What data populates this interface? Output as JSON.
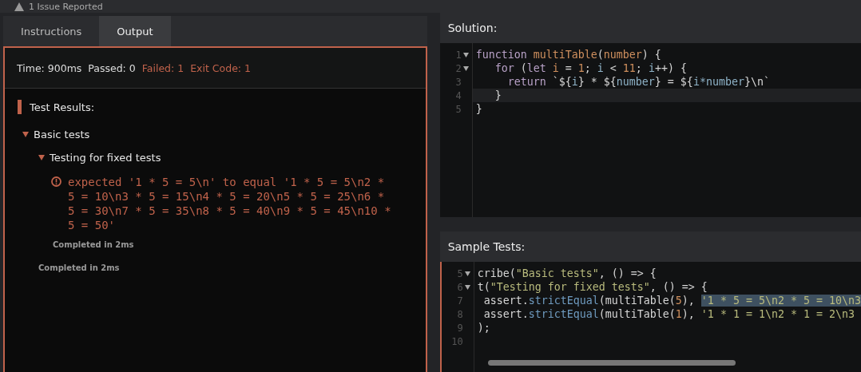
{
  "top_bar": {
    "text": "1 Issue Reported"
  },
  "tabs": [
    {
      "label": "Instructions",
      "selected": false
    },
    {
      "label": "Output",
      "selected": true
    }
  ],
  "output": {
    "stats": [
      {
        "text": "Time: 900ms",
        "failed": false
      },
      {
        "text": "Passed: 0",
        "failed": false
      },
      {
        "text": "Failed: 1",
        "failed": true
      },
      {
        "text": "Exit Code: 1",
        "failed": true
      }
    ],
    "heading": "Test Results:",
    "groups": [
      {
        "title": "Basic tests",
        "expanded": true,
        "completed": "Completed in 2ms",
        "children": [
          {
            "title": "Testing for fixed tests",
            "expanded": true,
            "completed": "Completed in 2ms",
            "error": "expected '1 * 5 = 5\\n' to equal '1 * 5 = 5\\n2 * 5 = 10\\n3 * 5 = 15\\n4 * 5 = 20\\n5 * 5 = 25\\n6 * 5 = 30\\n7 * 5 = 35\\n8 * 5 = 40\\n9 * 5 = 45\\n10 * 5 = 50'"
          }
        ]
      }
    ]
  },
  "solution": {
    "title": "Solution:",
    "lines": [
      {
        "number": "1",
        "foldable": true,
        "active": false,
        "tokens": [
          {
            "t": "function ",
            "kind": "kw"
          },
          {
            "t": "multiTable",
            "kind": "fn"
          },
          {
            "t": "(",
            "kind": "plain"
          },
          {
            "t": "number",
            "kind": "fn"
          },
          {
            "t": ") {",
            "kind": "plain"
          }
        ]
      },
      {
        "number": "2",
        "foldable": true,
        "active": false,
        "tokens": [
          {
            "t": "   for ",
            "kind": "kw"
          },
          {
            "t": "(",
            "kind": "plain"
          },
          {
            "t": "let ",
            "kind": "kw"
          },
          {
            "t": "i",
            "kind": "fn"
          },
          {
            "t": " = ",
            "kind": "plain"
          },
          {
            "t": "1",
            "kind": "fn"
          },
          {
            "t": "; ",
            "kind": "plain"
          },
          {
            "t": "i",
            "kind": "var"
          },
          {
            "t": " < ",
            "kind": "plain"
          },
          {
            "t": "11",
            "kind": "fn"
          },
          {
            "t": "; ",
            "kind": "plain"
          },
          {
            "t": "i",
            "kind": "var"
          },
          {
            "t": "++) {",
            "kind": "plain"
          }
        ]
      },
      {
        "number": "3",
        "foldable": false,
        "active": false,
        "tokens": [
          {
            "t": "     return ",
            "kind": "kw"
          },
          {
            "t": "`${",
            "kind": "plain"
          },
          {
            "t": "i",
            "kind": "var"
          },
          {
            "t": "} * ${",
            "kind": "plain"
          },
          {
            "t": "number",
            "kind": "var"
          },
          {
            "t": "} = ${",
            "kind": "plain"
          },
          {
            "t": "i*number",
            "kind": "var"
          },
          {
            "t": "}\\n`",
            "kind": "plain"
          }
        ]
      },
      {
        "number": "4",
        "foldable": false,
        "active": true,
        "tokens": [
          {
            "t": "   }",
            "kind": "plain"
          }
        ]
      },
      {
        "number": "5",
        "foldable": false,
        "active": false,
        "tokens": [
          {
            "t": "}",
            "kind": "plain"
          }
        ]
      }
    ]
  },
  "sample_tests": {
    "title": "Sample Tests:",
    "lines": [
      {
        "number": "5",
        "foldable": true,
        "active": false,
        "tokens": [
          {
            "t": "cribe(",
            "kind": "plain"
          },
          {
            "t": "\"Basic tests\"",
            "kind": "str"
          },
          {
            "t": ", () => {",
            "kind": "plain"
          }
        ]
      },
      {
        "number": "6",
        "foldable": true,
        "active": false,
        "tokens": [
          {
            "t": "t(",
            "kind": "plain"
          },
          {
            "t": "\"Testing for fixed tests\"",
            "kind": "str"
          },
          {
            "t": ", () => {",
            "kind": "plain"
          }
        ]
      },
      {
        "number": "7",
        "foldable": false,
        "active": false,
        "tokens": [
          {
            "t": " assert.",
            "kind": "plain"
          },
          {
            "t": "strictEqual",
            "kind": "method"
          },
          {
            "t": "(multiTable(",
            "kind": "plain"
          },
          {
            "t": "5",
            "kind": "fn"
          },
          {
            "t": "), ",
            "kind": "plain"
          },
          {
            "t": "'1 * 5 = 5\\n2 * 5 = 10\\n3",
            "kind": "selected"
          }
        ]
      },
      {
        "number": "8",
        "foldable": false,
        "active": false,
        "tokens": [
          {
            "t": " assert.",
            "kind": "plain"
          },
          {
            "t": "strictEqual",
            "kind": "method"
          },
          {
            "t": "(multiTable(",
            "kind": "plain"
          },
          {
            "t": "1",
            "kind": "fn"
          },
          {
            "t": "), ",
            "kind": "plain"
          },
          {
            "t": "'1 * 1 = 1\\n2 * 1 = 2\\n3",
            "kind": "str"
          }
        ]
      },
      {
        "number": "9",
        "foldable": false,
        "active": false,
        "tokens": [
          {
            "t": ");",
            "kind": "plain"
          }
        ]
      },
      {
        "number": "10",
        "foldable": false,
        "active": false
      }
    ]
  }
}
